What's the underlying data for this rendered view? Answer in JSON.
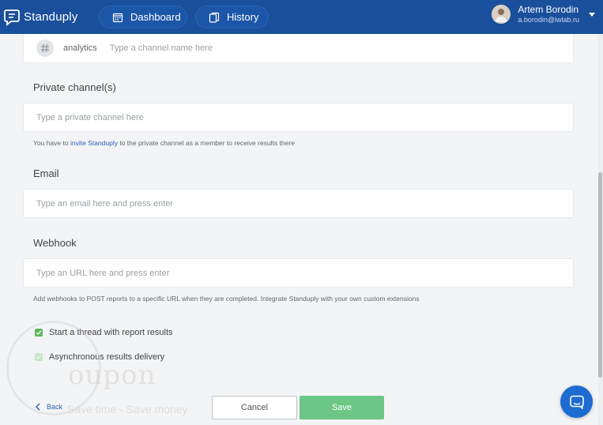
{
  "app": {
    "name": "Standuply"
  },
  "nav": {
    "dashboard": "Dashboard",
    "history": "History"
  },
  "user": {
    "name": "Artem Borodin",
    "email": "a.borodin@iwlab.ru"
  },
  "channels": {
    "chip_label": "analytics",
    "input_placeholder": "Type a channel name here"
  },
  "private": {
    "label": "Private channel(s)",
    "placeholder": "Type a private channel here",
    "hint_before": "You have to ",
    "hint_link": "invite Standuply",
    "hint_after": " to the private channel as a member to receive results there"
  },
  "email": {
    "label": "Email",
    "placeholder": "Type an email here and press enter"
  },
  "webhook": {
    "label": "Webhook",
    "placeholder": "Type an URL here and press enter",
    "hint": "Add webhooks to POST reports to a specific URL when they are completed. Integrate Standuply with your own custom extensions"
  },
  "options": {
    "thread": {
      "label": "Start a thread with report results",
      "checked": true
    },
    "async": {
      "label": "Asynchronous results delivery",
      "checked": false
    }
  },
  "footer": {
    "back": "Back",
    "cancel": "Cancel",
    "save": "Save"
  },
  "watermark": {
    "brand": "oupon",
    "tagline": "Save time - Save money"
  },
  "colors": {
    "topbar": "#1a4f9c",
    "save": "#6cc686",
    "link": "#2b62b3",
    "check": "#5cb85c"
  }
}
